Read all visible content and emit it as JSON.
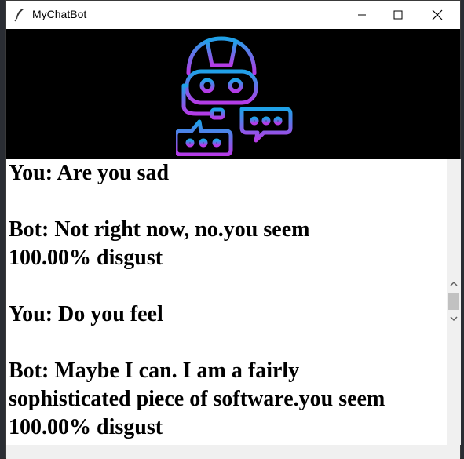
{
  "window": {
    "title": "MyChatBot"
  },
  "chat": {
    "messages": [
      "You: Are you sad",
      "Bot: Not right now, no.you seem",
      "100.00% disgust",
      "You: Do you feel",
      "Bot: Maybe I can. I am a fairly",
      "sophisticated piece of software.you seem",
      "100.00% disgust"
    ]
  },
  "icons": {
    "app": "feather-icon",
    "minimize": "minimize-icon",
    "maximize": "maximize-icon",
    "close": "close-icon",
    "logo": "robot-chat-icon",
    "scroll_up": "chevron-up-icon",
    "scroll_down": "chevron-down-icon"
  },
  "colors": {
    "logo_gradient_start": "#1fa2e8",
    "logo_gradient_end": "#b53be6",
    "banner_bg": "#000000",
    "chat_bg": "#ffffff"
  }
}
